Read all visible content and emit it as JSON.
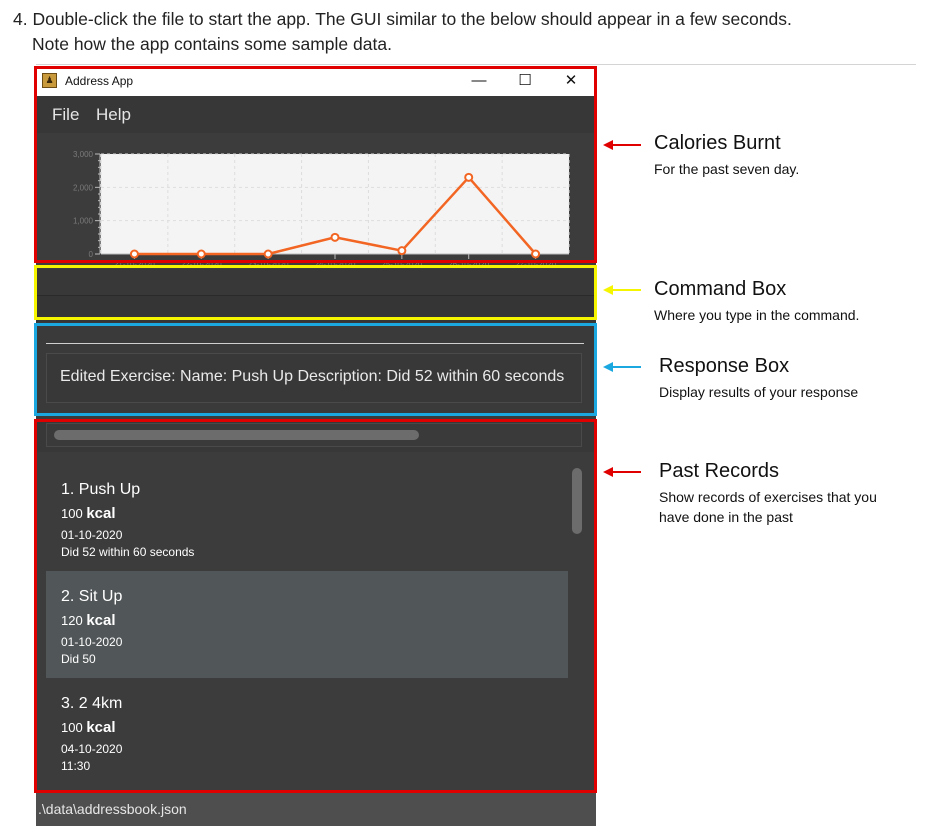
{
  "instruction": {
    "line1": "4. Double-click the file to start the app. The GUI similar to the below should appear in a few seconds.",
    "line2": "Note how the app contains some sample data."
  },
  "window": {
    "title": "Address App",
    "minimize": "—",
    "maximize": "☐",
    "close": "✕"
  },
  "menu": {
    "file": "File",
    "help": "Help"
  },
  "chart_data": {
    "type": "line",
    "x": [
      "21-10-2020",
      "22-10-2020",
      "23-10-2020",
      "24-10-2020",
      "25-10-2020",
      "26-10-2020",
      "27-10-2020"
    ],
    "values": [
      0,
      0,
      0,
      500,
      100,
      2300,
      0
    ],
    "ytick_labels": [
      "3,000",
      "2,000",
      "1,000",
      "0"
    ],
    "ylim": [
      0,
      3000
    ],
    "grid": true,
    "line_color": "#f26522"
  },
  "response": {
    "text": "Edited Exercise: Name: Push Up Description: Did 52 within 60 seconds"
  },
  "records": [
    {
      "name": "1.  Push Up",
      "cal_num": "100",
      "cal_unit": "kcal",
      "date": "01-10-2020",
      "desc": "Did 52 within 60 seconds"
    },
    {
      "name": "2.  Sit Up",
      "cal_num": "120",
      "cal_unit": "kcal",
      "date": "01-10-2020",
      "desc": "Did 50"
    },
    {
      "name": "3.  2 4km",
      "cal_num": "100",
      "cal_unit": "kcal",
      "date": "04-10-2020",
      "desc": "11:30"
    }
  ],
  "status": {
    "path": ".\\data\\addressbook.json"
  },
  "annotations": {
    "calories": {
      "title": "Calories Burnt",
      "sub": "For the past seven day.",
      "color": "#e00000"
    },
    "command": {
      "title": "Command Box",
      "sub": "Where you type in the command.",
      "color": "#f5f500"
    },
    "response": {
      "title": "Response Box",
      "sub": "Display results of your response",
      "color": "#1ba7e0"
    },
    "past": {
      "title": "Past Records",
      "sub1": "Show records of exercises that you",
      "sub2": "have done in the past",
      "color": "#e00000"
    }
  }
}
